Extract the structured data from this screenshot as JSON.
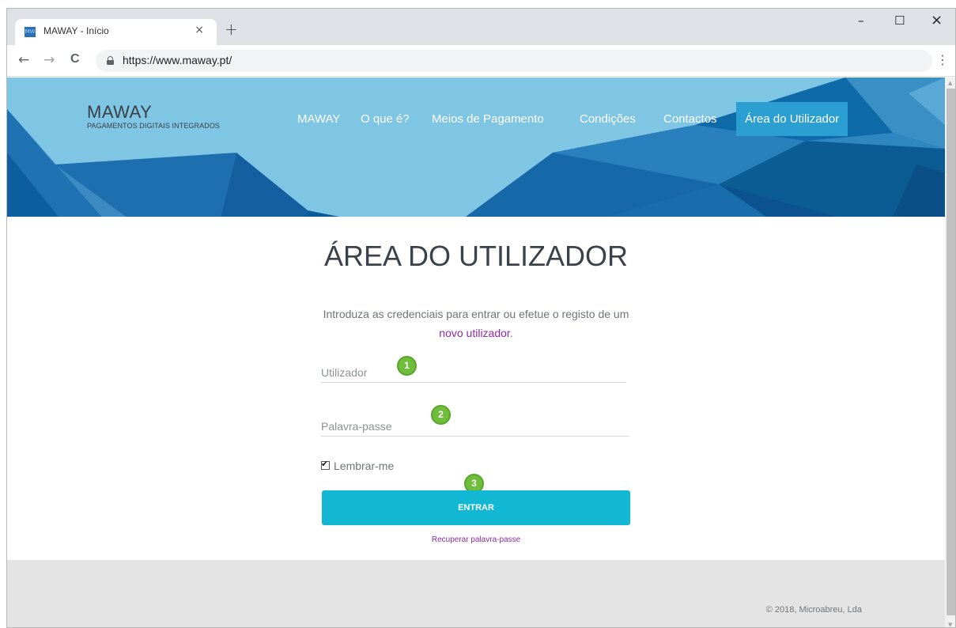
{
  "browser": {
    "tab_title": "MAWAY - Início",
    "tab_favicon_text": "MW",
    "close_tab_glyph": "×",
    "new_tab_glyph": "+",
    "back_glyph": "←",
    "forward_glyph": "→",
    "reload_glyph": "C",
    "minimize_glyph": "–",
    "maximize_glyph": "☐",
    "close_glyph": "×",
    "url": "https://www.maway.pt/",
    "menu_glyph": "⋮",
    "icons": [
      "favicon",
      "close-icon",
      "plus-icon",
      "back-arrow-icon",
      "forward-arrow-icon",
      "reload-icon",
      "lock-icon",
      "kebab-menu-icon"
    ]
  },
  "header": {
    "logo_name": "MAWAY",
    "logo_tagline": "PAGAMENTOS DIGITAIS INTEGRADOS",
    "nav": [
      {
        "label": "MAWAY"
      },
      {
        "label": "O que é?"
      },
      {
        "label": "Meios de Pagamento"
      },
      {
        "label": "Condições"
      },
      {
        "label": "Contactos"
      },
      {
        "label": "Área do Utilizador",
        "active": true
      }
    ],
    "active_color": "#2b9fd1"
  },
  "login": {
    "title": "ÁREA DO UTILIZADOR",
    "intro_text": "Introduza as credenciais para entrar ou efetue o registo de um",
    "intro_link": "novo utilizador",
    "intro_end": ".",
    "username_placeholder": "Utilizador",
    "password_placeholder": "Palavra-passe",
    "remember_label": "Lembrar-me",
    "remember_checked": true,
    "submit_label": "ENTRAR",
    "recover_label": "Recuperar palavra-passe",
    "button_color": "#12b7d4",
    "link_color": "#8e2aa3"
  },
  "annotations": {
    "badge_1": "1",
    "badge_2": "2",
    "badge_3": "3",
    "badge_color": "#6fbd3a"
  },
  "footer": {
    "copyright": "© 2018, Microabreu, Lda"
  }
}
